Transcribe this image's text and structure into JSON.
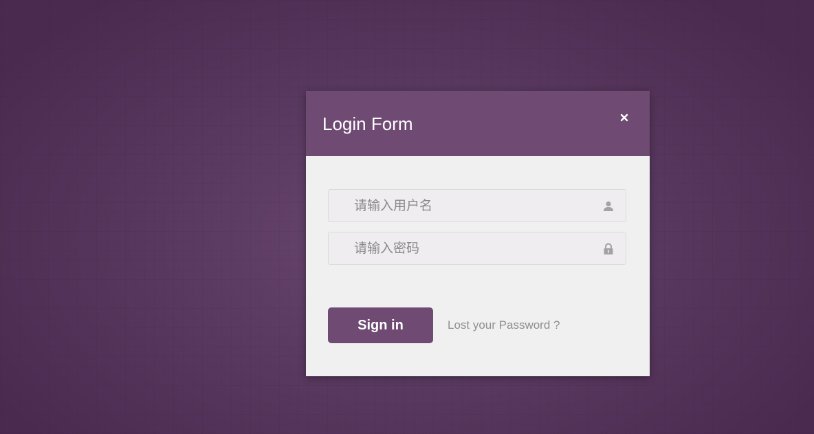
{
  "modal": {
    "title": "Login Form",
    "close_icon": "close-icon"
  },
  "form": {
    "username": {
      "value": "",
      "placeholder": "请输入用户名",
      "icon": "user-icon"
    },
    "password": {
      "value": "",
      "placeholder": "请输入密码",
      "icon": "lock-icon"
    },
    "signin_label": "Sign in",
    "lost_password_label": "Lost your Password ?"
  },
  "colors": {
    "accent": "#6f4a73",
    "background": "#5a3a60",
    "panel": "#f1f0f1"
  }
}
